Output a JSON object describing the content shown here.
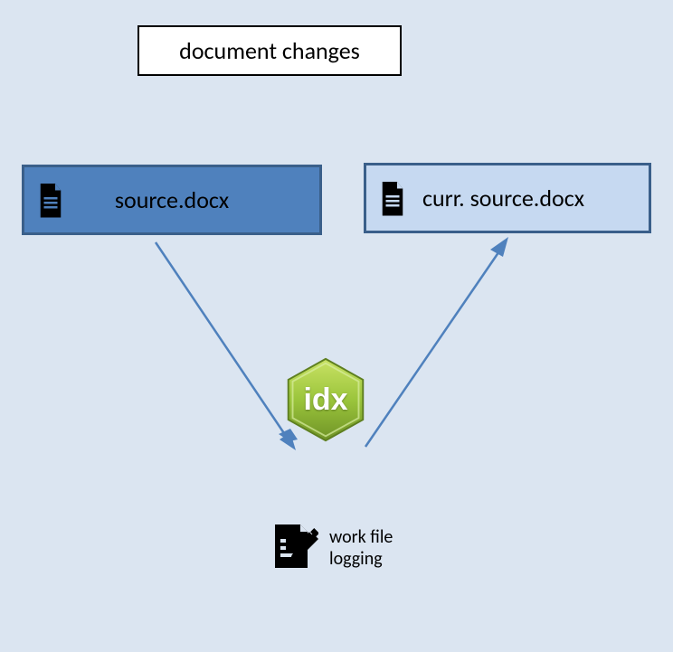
{
  "title": "document changes",
  "box_source": {
    "label": "source.docx",
    "icon": "document-icon"
  },
  "box_current": {
    "label": "curr. source.docx",
    "icon": "document-icon"
  },
  "center_badge": {
    "label": "idx"
  },
  "work_file": {
    "line1": "work file",
    "line2": "logging",
    "icon": "edit-document-icon"
  },
  "colors": {
    "bg": "#dbe5f1",
    "box_dark": "#4f81bd",
    "box_light": "#c6d9f1",
    "border": "#3a5f8a",
    "hex_light": "#b7d749",
    "hex_dark": "#7fa52e"
  }
}
